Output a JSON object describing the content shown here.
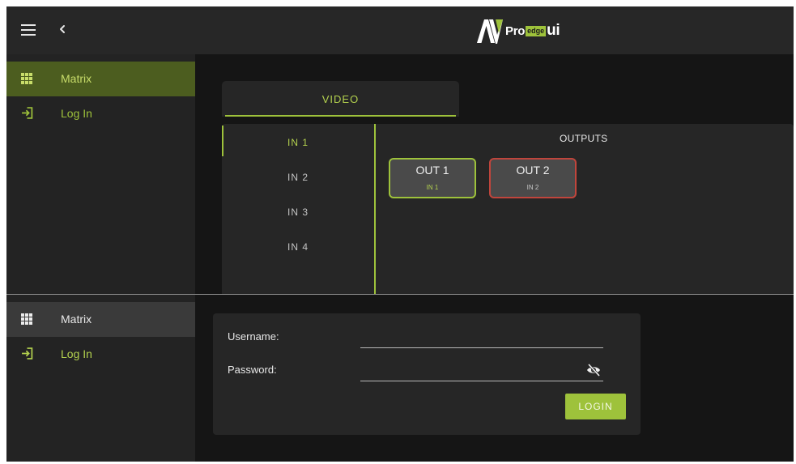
{
  "brand": {
    "av": "AV",
    "pro": "Pro",
    "edge": "edge",
    "ui": "ui"
  },
  "top_sidebar": {
    "items": [
      {
        "label": "Matrix",
        "icon": "grid-icon",
        "active": true
      },
      {
        "label": "Log In",
        "icon": "login-icon",
        "active": false
      }
    ]
  },
  "bottom_sidebar": {
    "items": [
      {
        "label": "Matrix",
        "icon": "grid-icon",
        "active": false
      },
      {
        "label": "Log In",
        "icon": "login-icon",
        "active": true
      }
    ]
  },
  "video_tab": {
    "label": "VIDEO"
  },
  "matrix": {
    "inputs": [
      "IN 1",
      "IN 2",
      "IN 3",
      "IN 4"
    ],
    "selected_input": "IN 1",
    "outputs_title": "OUTPUTS",
    "outputs": [
      {
        "label": "OUT 1",
        "source": "IN 1",
        "state": "active"
      },
      {
        "label": "OUT 2",
        "source": "IN 2",
        "state": "inactive"
      }
    ]
  },
  "login": {
    "username_label": "Username:",
    "password_label": "Password:",
    "username_value": "",
    "password_value": "",
    "login_button": "LOGIN"
  },
  "colors": {
    "accent": "#9ec23b",
    "active_row": "#4c5d1f",
    "output_active_border": "#9ec23b",
    "output_inactive_border": "#c0453c",
    "background": "#151515",
    "panel": "#262626"
  }
}
